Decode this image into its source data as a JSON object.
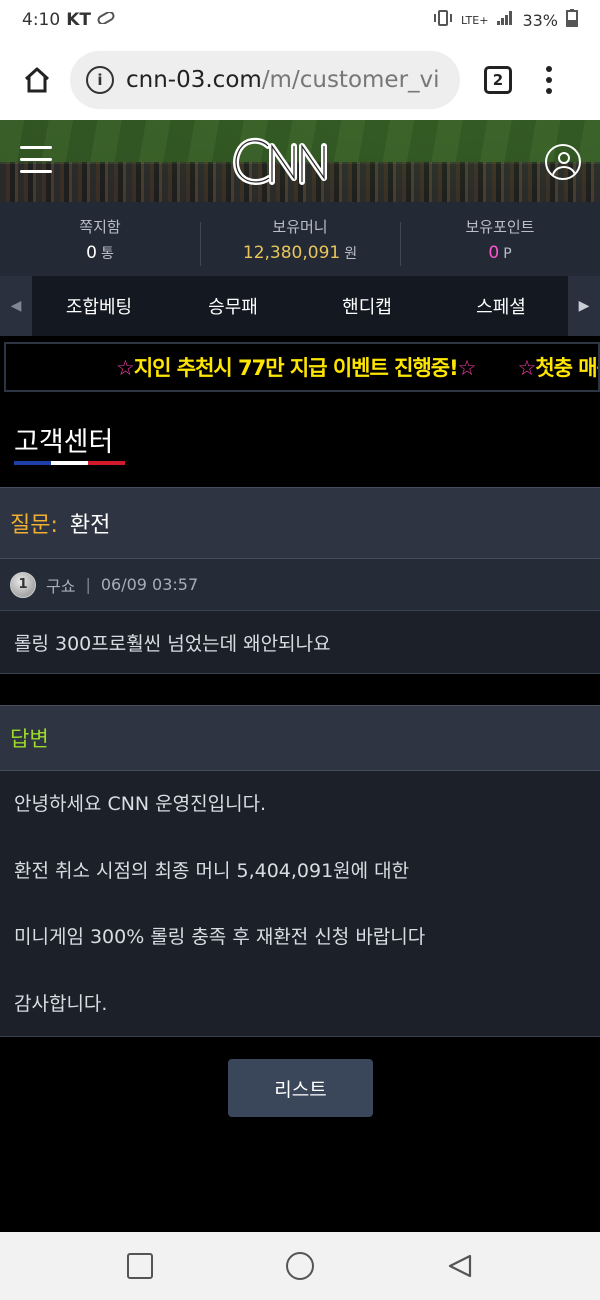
{
  "status_bar": {
    "time": "4:10",
    "carrier": "KT",
    "network": "LTE+",
    "battery": "33%"
  },
  "browser": {
    "url_domain": "cnn-03.com",
    "url_path": "/m/customer_vi",
    "tab_count": "2"
  },
  "header": {
    "logo_text": "CNN"
  },
  "account": {
    "messages": {
      "label": "쪽지함",
      "value": "0",
      "unit": "통"
    },
    "money": {
      "label": "보유머니",
      "value": "12,380,091",
      "unit": "원"
    },
    "points": {
      "label": "보유포인트",
      "value": "0",
      "unit": "P"
    }
  },
  "game_tabs": [
    "조합베팅",
    "승무패",
    "핸디캡",
    "스페셜"
  ],
  "marquee": {
    "item1": "지인 추천시 77만 지급 이벤트 진행중!",
    "item2": "첫충 매충",
    "star": "☆"
  },
  "page": {
    "title": "고객센터"
  },
  "question": {
    "label": "질문:",
    "title": "환전",
    "level": "1",
    "author": "구쇼",
    "separator": "|",
    "datetime": "06/09 03:57",
    "body": "롤링 300프로훨씬 넘었는데 왜안되나요"
  },
  "answer": {
    "label": "답변",
    "lines": [
      "안녕하세요 CNN 운영진입니다.",
      "환전 취소 시점의 최종 머니 5,404,091원에 대한",
      "미니게임 300% 롤링 충족 후 재환전 신청 바랍니다",
      "감사합니다."
    ]
  },
  "buttons": {
    "list": "리스트"
  },
  "colors": {
    "accent_gold": "#e8c45a",
    "question_label": "#f0b132",
    "answer_label": "#9bdc2a",
    "points_pink": "#ff55cc",
    "marquee_yellow": "#ffe600",
    "underline": [
      "#1e3fa8",
      "#ffffff",
      "#d21b2a"
    ]
  }
}
